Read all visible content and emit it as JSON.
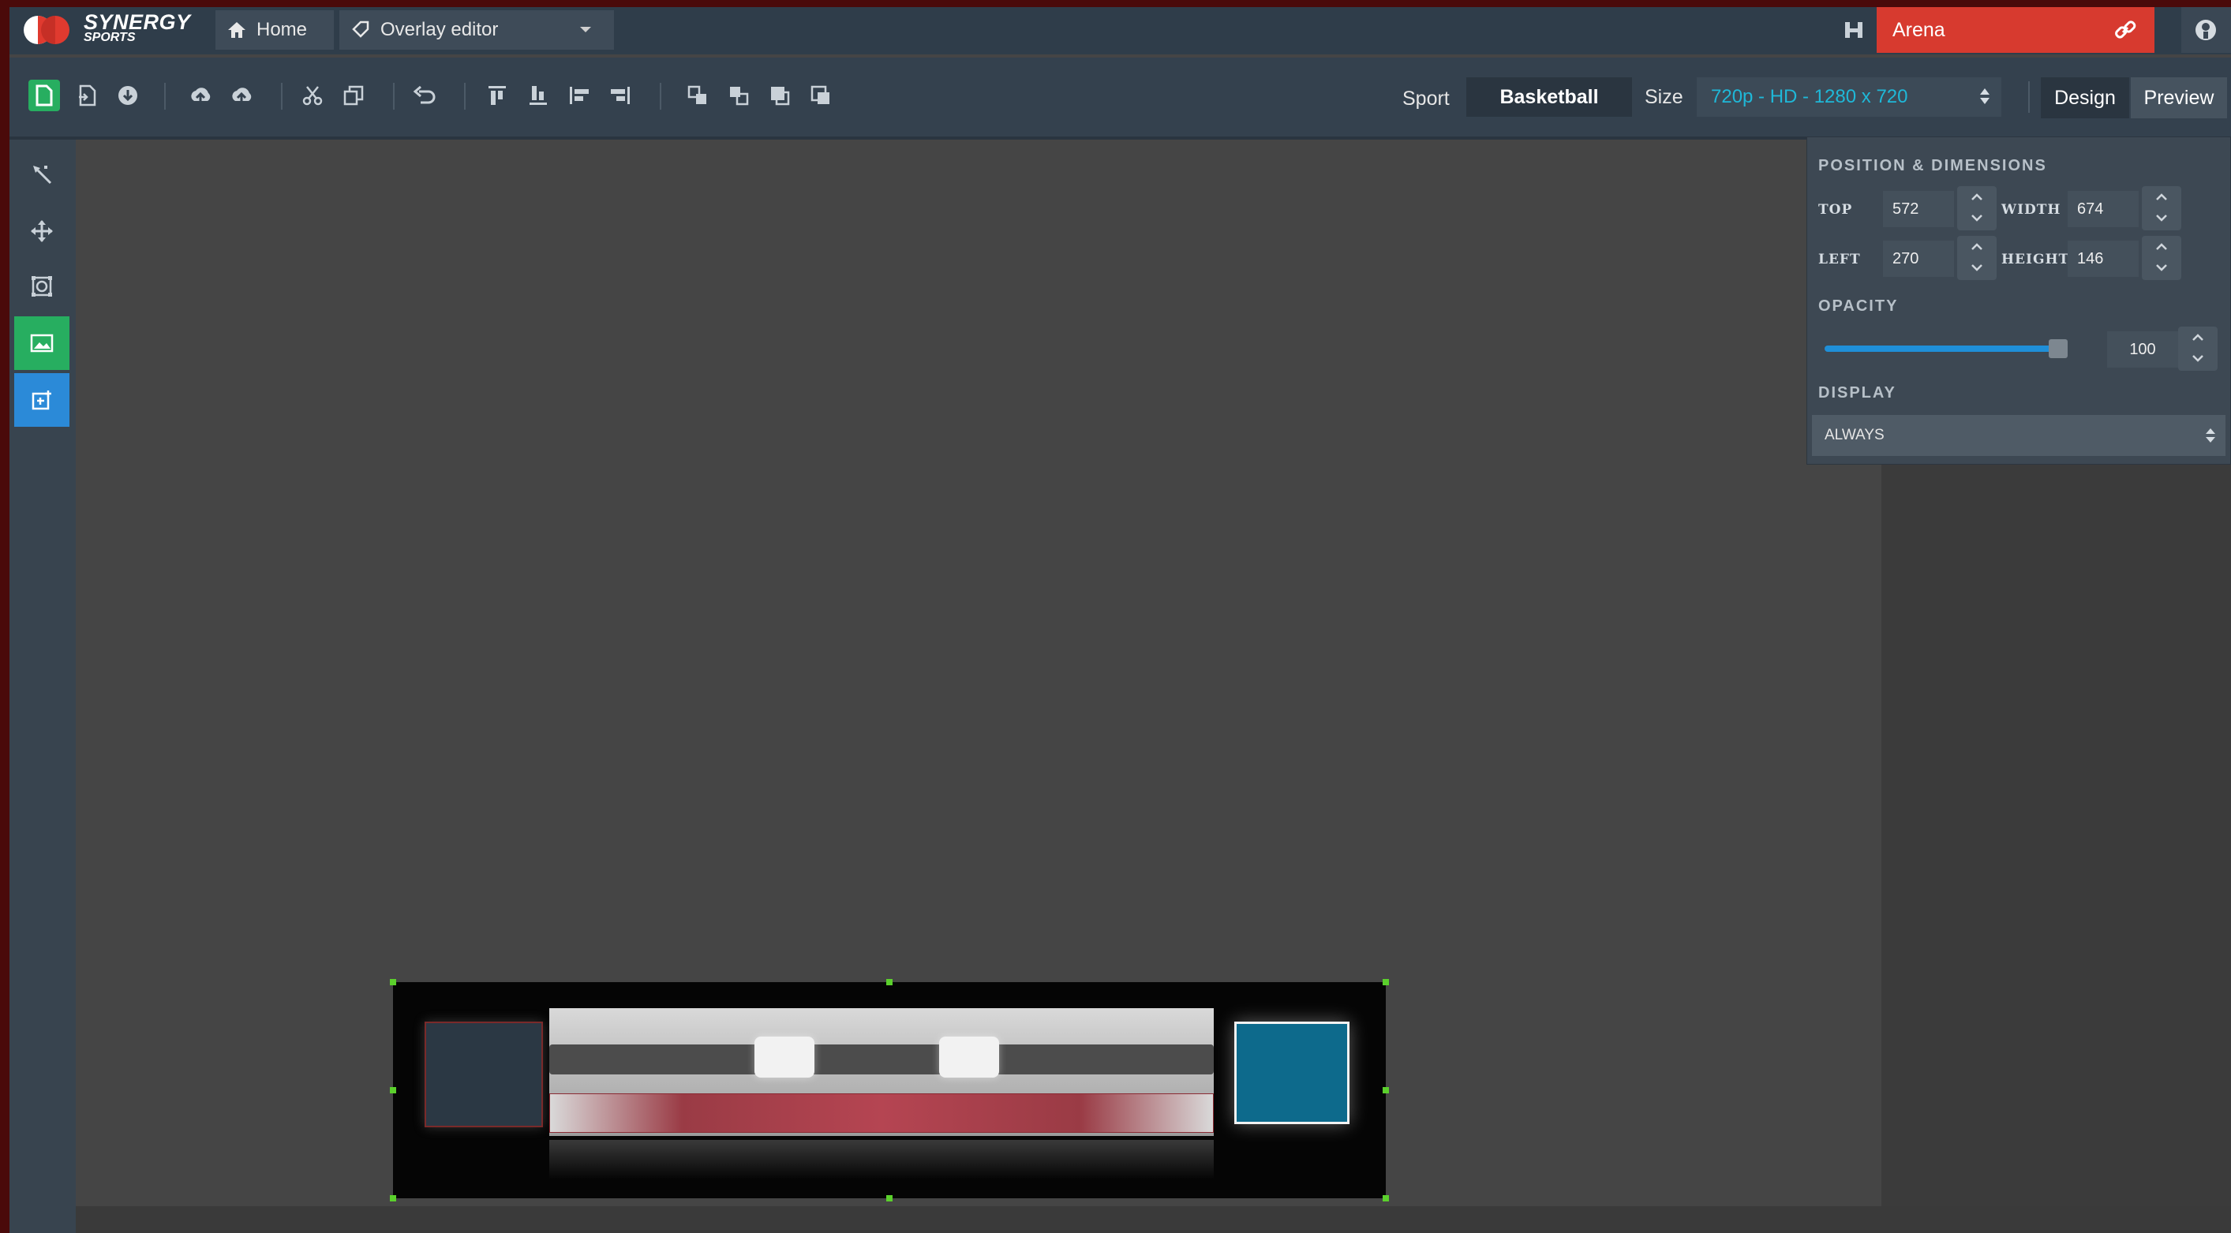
{
  "app": {
    "logo_line1": "SYNERGY",
    "logo_line2": "SPORTS",
    "home_label": "Home",
    "editor_label": "Overlay editor",
    "venue_label": "Arena"
  },
  "toolbar": {
    "sport_label": "Sport",
    "sport_value": "Basketball",
    "size_label": "Size",
    "size_value": "720p - HD - 1280 x 720",
    "design_label": "Design",
    "preview_label": "Preview",
    "icons": [
      "new-document-icon",
      "import-icon",
      "download-icon",
      "upload-icon",
      "upload-alt-icon",
      "cut-icon",
      "copy-icon",
      "undo-icon",
      "align-top-icon",
      "align-bottom-icon",
      "align-left-icon",
      "align-right-icon",
      "bring-forward-icon",
      "send-backward-icon",
      "bring-to-front-icon",
      "send-to-back-icon"
    ]
  },
  "left_tools": [
    "select-icon",
    "move-icon",
    "transform-icon",
    "image-icon",
    "add-element-icon"
  ],
  "properties": {
    "position_title": "POSITION & DIMENSIONS",
    "top_label": "TOP",
    "top_value": "572",
    "left_label": "LEFT",
    "left_value": "270",
    "width_label": "WIDTH",
    "width_value": "674",
    "height_label": "HEIGHT",
    "height_value": "146",
    "opacity_title": "OPACITY",
    "opacity_value": "100",
    "display_title": "DISPLAY",
    "display_value": "ALWAYS"
  },
  "colors": {
    "accent_green": "#27ae60",
    "arena_red": "#d73a2f",
    "size_text": "#1fb8d8",
    "selection_handle": "#5bd02c"
  }
}
